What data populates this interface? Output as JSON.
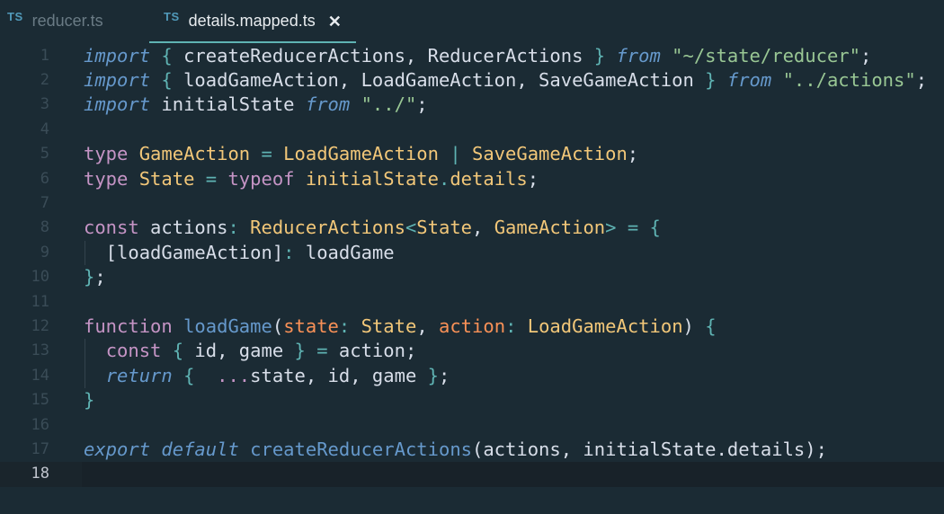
{
  "tabs": [
    {
      "icon": "TS",
      "label": "reducer.ts",
      "active": false
    },
    {
      "icon": "TS",
      "label": "details.mapped.ts",
      "active": true,
      "close": "✕"
    }
  ],
  "editor": {
    "current_line": 18,
    "lines": [
      {
        "n": "1",
        "tokens": [
          [
            "k-it",
            "import"
          ],
          [
            "k-tx",
            " "
          ],
          [
            "k-pn",
            "{"
          ],
          [
            "k-tx",
            " createReducerActions, ReducerActions "
          ],
          [
            "k-pn",
            "}"
          ],
          [
            "k-tx",
            " "
          ],
          [
            "k-it",
            "from"
          ],
          [
            "k-tx",
            " "
          ],
          [
            "k-st",
            "\"~/state/reducer\""
          ],
          [
            "k-tx",
            ";"
          ]
        ]
      },
      {
        "n": "2",
        "tokens": [
          [
            "k-it",
            "import"
          ],
          [
            "k-tx",
            " "
          ],
          [
            "k-pn",
            "{"
          ],
          [
            "k-tx",
            " loadGameAction, LoadGameAction, SaveGameAction "
          ],
          [
            "k-pn",
            "}"
          ],
          [
            "k-tx",
            " "
          ],
          [
            "k-it",
            "from"
          ],
          [
            "k-tx",
            " "
          ],
          [
            "k-st",
            "\"../actions\""
          ],
          [
            "k-tx",
            ";"
          ]
        ]
      },
      {
        "n": "3",
        "tokens": [
          [
            "k-it",
            "import"
          ],
          [
            "k-tx",
            " initialState "
          ],
          [
            "k-it",
            "from"
          ],
          [
            "k-tx",
            " "
          ],
          [
            "k-st",
            "\"../\""
          ],
          [
            "k-tx",
            ";"
          ]
        ]
      },
      {
        "n": "4",
        "tokens": []
      },
      {
        "n": "5",
        "tokens": [
          [
            "k-pl",
            "type"
          ],
          [
            "k-tx",
            " "
          ],
          [
            "k-ty",
            "GameAction"
          ],
          [
            "k-tx",
            " "
          ],
          [
            "k-pn",
            "="
          ],
          [
            "k-tx",
            " "
          ],
          [
            "k-ty",
            "LoadGameAction"
          ],
          [
            "k-tx",
            " "
          ],
          [
            "k-pn",
            "|"
          ],
          [
            "k-tx",
            " "
          ],
          [
            "k-ty",
            "SaveGameAction"
          ],
          [
            "k-tx",
            ";"
          ]
        ]
      },
      {
        "n": "6",
        "tokens": [
          [
            "k-pl",
            "type"
          ],
          [
            "k-tx",
            " "
          ],
          [
            "k-ty",
            "State"
          ],
          [
            "k-tx",
            " "
          ],
          [
            "k-pn",
            "="
          ],
          [
            "k-tx",
            " "
          ],
          [
            "k-pl",
            "typeof"
          ],
          [
            "k-tx",
            " "
          ],
          [
            "k-ty",
            "initialState"
          ],
          [
            "k-pn",
            "."
          ],
          [
            "k-ty",
            "details"
          ],
          [
            "k-tx",
            ";"
          ]
        ]
      },
      {
        "n": "7",
        "tokens": []
      },
      {
        "n": "8",
        "tokens": [
          [
            "k-pl",
            "const"
          ],
          [
            "k-tx",
            " actions"
          ],
          [
            "k-pn",
            ":"
          ],
          [
            "k-tx",
            " "
          ],
          [
            "k-ty",
            "ReducerActions"
          ],
          [
            "k-pn",
            "<"
          ],
          [
            "k-ty",
            "State"
          ],
          [
            "k-tx",
            ", "
          ],
          [
            "k-ty",
            "GameAction"
          ],
          [
            "k-pn",
            ">"
          ],
          [
            "k-tx",
            " "
          ],
          [
            "k-pn",
            "="
          ],
          [
            "k-tx",
            " "
          ],
          [
            "k-pn",
            "{"
          ]
        ]
      },
      {
        "n": "9",
        "indent": true,
        "tokens": [
          [
            "k-tx",
            "  [loadGameAction]"
          ],
          [
            "k-pn",
            ":"
          ],
          [
            "k-tx",
            " loadGame"
          ]
        ]
      },
      {
        "n": "10",
        "tokens": [
          [
            "k-pn",
            "}"
          ],
          [
            "k-tx",
            ";"
          ]
        ]
      },
      {
        "n": "11",
        "tokens": []
      },
      {
        "n": "12",
        "tokens": [
          [
            "k-pl",
            "function"
          ],
          [
            "k-tx",
            " "
          ],
          [
            "k-fn",
            "loadGame"
          ],
          [
            "k-tx",
            "("
          ],
          [
            "k-pa",
            "state"
          ],
          [
            "k-pn",
            ":"
          ],
          [
            "k-tx",
            " "
          ],
          [
            "k-ty",
            "State"
          ],
          [
            "k-tx",
            ", "
          ],
          [
            "k-pa",
            "action"
          ],
          [
            "k-pn",
            ":"
          ],
          [
            "k-tx",
            " "
          ],
          [
            "k-ty",
            "LoadGameAction"
          ],
          [
            "k-tx",
            ") "
          ],
          [
            "k-pn",
            "{"
          ]
        ]
      },
      {
        "n": "13",
        "indent": true,
        "tokens": [
          [
            "k-tx",
            "  "
          ],
          [
            "k-pl",
            "const"
          ],
          [
            "k-tx",
            " "
          ],
          [
            "k-pn",
            "{"
          ],
          [
            "k-tx",
            " id, game "
          ],
          [
            "k-pn",
            "}"
          ],
          [
            "k-tx",
            " "
          ],
          [
            "k-pn",
            "="
          ],
          [
            "k-tx",
            " action;"
          ]
        ]
      },
      {
        "n": "14",
        "indent": true,
        "tokens": [
          [
            "k-tx",
            "  "
          ],
          [
            "k-it",
            "return"
          ],
          [
            "k-tx",
            " "
          ],
          [
            "k-pn",
            "{"
          ],
          [
            "k-tx",
            "  "
          ],
          [
            "k-pl",
            "..."
          ],
          [
            "k-tx",
            "state, id, game "
          ],
          [
            "k-pn",
            "}"
          ],
          [
            "k-tx",
            ";"
          ]
        ]
      },
      {
        "n": "15",
        "tokens": [
          [
            "k-pn",
            "}"
          ]
        ]
      },
      {
        "n": "16",
        "tokens": []
      },
      {
        "n": "17",
        "tokens": [
          [
            "k-it",
            "export"
          ],
          [
            "k-tx",
            " "
          ],
          [
            "k-it",
            "default"
          ],
          [
            "k-tx",
            " "
          ],
          [
            "k-fn",
            "createReducerActions"
          ],
          [
            "k-tx",
            "(actions, initialState.details);"
          ]
        ]
      },
      {
        "n": "18",
        "tokens": []
      }
    ]
  }
}
